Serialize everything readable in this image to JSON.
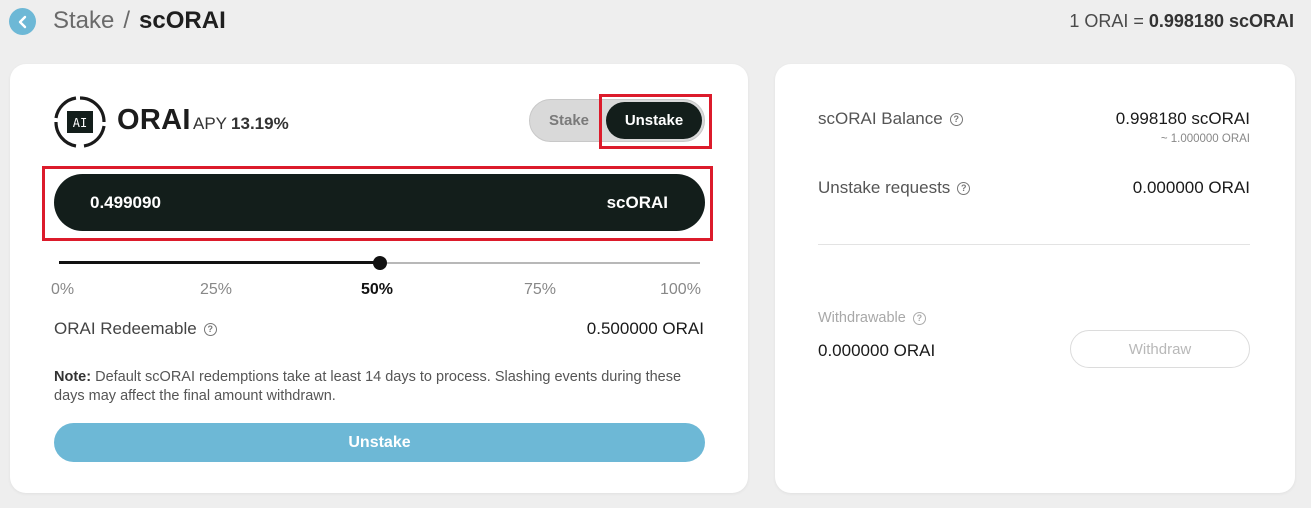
{
  "header": {
    "breadcrumb_parent": "Stake",
    "breadcrumb_separator": "/",
    "breadcrumb_current": "scORAI",
    "rate_prefix": "1 ORAI = ",
    "rate_value": "0.998180 scORAI"
  },
  "stake_panel": {
    "token_name": "ORAI",
    "logo_text": "AI",
    "apy_label": "APY",
    "apy_value": "13.19%",
    "mode_tabs": {
      "stake": "Stake",
      "unstake": "Unstake",
      "selected": "Unstake"
    },
    "amount": {
      "value": "0.499090",
      "unit": "scORAI"
    },
    "slider": {
      "percent": 50,
      "ticks": [
        "0%",
        "25%",
        "50%",
        "75%",
        "100%"
      ],
      "active_tick": "50%"
    },
    "redeemable_label": "ORAI Redeemable",
    "redeemable_value": "0.500000 ORAI",
    "note_label": "Note:",
    "note_text": " Default scORAI redemptions take at least 14 days to process. Slashing events during these days may affect the final amount withdrawn.",
    "submit_label": "Unstake"
  },
  "balance_panel": {
    "balance_label": "scORAI Balance",
    "balance_value": "0.998180 scORAI",
    "balance_sub": "~ 1.000000 ORAI",
    "requests_label": "Unstake requests",
    "requests_value": "0.000000 ORAI",
    "withdrawable_label": "Withdrawable",
    "withdrawable_value": "0.000000 ORAI",
    "withdraw_button": "Withdraw"
  },
  "colors": {
    "accent": "#6db8d6",
    "dark": "#131e1b",
    "highlight": "#dc1b2b",
    "background": "#eeeeee"
  },
  "icons": {
    "back": "chevron-left-icon",
    "help": "help-circle-icon",
    "token": "orai-logo-icon"
  }
}
